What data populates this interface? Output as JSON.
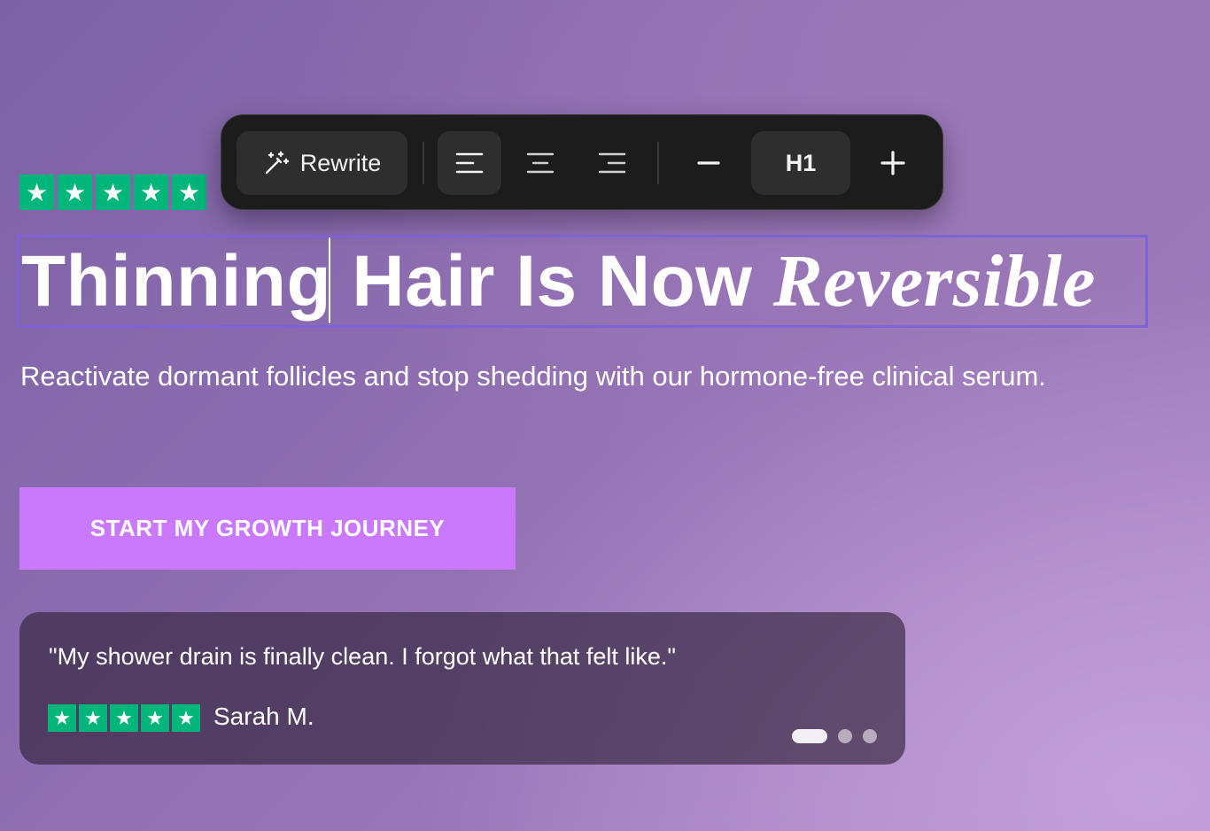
{
  "rating": {
    "stars": 5,
    "star_glyph": "★",
    "color": "#00b67a"
  },
  "toolbar": {
    "rewrite_label": "Rewrite",
    "rewrite_icon": "magic-wand-icon",
    "align_options": [
      "align-left-icon",
      "align-center-icon",
      "align-right-icon"
    ],
    "selected_align": "left",
    "decrease_icon": "minus-icon",
    "heading_level": "H1",
    "increase_icon": "plus-icon"
  },
  "hero": {
    "headline_part1": "Thinning ",
    "headline_part2": "Hair Is Now ",
    "headline_italic": "Reversible",
    "subtitle": "Reactivate dormant follicles and stop shedding with our hormone-free clinical serum.",
    "cta_label": "START MY GROWTH JOURNEY",
    "cta_color": "#ca78fc"
  },
  "review": {
    "quote": "\"My shower drain is finally clean. I forgot what that felt like.\"",
    "author": "Sarah M.",
    "stars": 5,
    "carousel_total": 3,
    "carousel_active": 1
  },
  "colors": {
    "selection_outline": "#7f62d4",
    "toolbar_bg": "#1c1c1c"
  }
}
